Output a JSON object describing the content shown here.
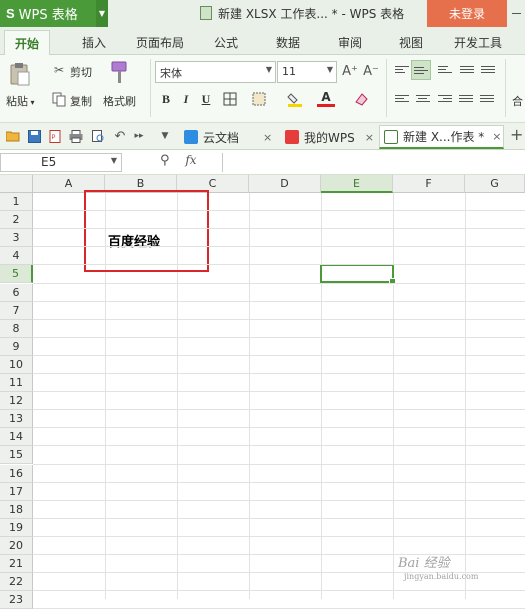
{
  "app": {
    "logo_letter": "S",
    "name": "WPS 表格",
    "window_title": "新建 XLSX 工作表... * - WPS 表格",
    "login_label": "未登录"
  },
  "ribbon_tabs": [
    "开始",
    "插入",
    "页面布局",
    "公式",
    "数据",
    "审阅",
    "视图",
    "开发工具"
  ],
  "ribbon": {
    "cut_label": "剪切",
    "copy_label": "复制",
    "paste_label": "粘贴",
    "format_painter_label": "格式刷",
    "font_name": "宋体",
    "font_size": "11",
    "bold": "B",
    "italic": "I",
    "underline": "U",
    "font_color_letter": "A",
    "grow_font": "A⁺",
    "shrink_font": "A⁻",
    "truncated_group": "合"
  },
  "doc_tabs": [
    {
      "label": "云文档",
      "close": "×"
    },
    {
      "label": "我的WPS",
      "close": "×"
    },
    {
      "label": "新建 X...作表 *",
      "close": "×"
    }
  ],
  "formula_bar": {
    "name_box": "E5",
    "fx_label": "fx",
    "formula": ""
  },
  "sheet": {
    "columns": [
      "A",
      "B",
      "C",
      "D",
      "E",
      "F",
      "G"
    ],
    "rows": [
      "1",
      "2",
      "3",
      "4",
      "5",
      "6",
      "7",
      "8",
      "9",
      "10",
      "11",
      "12",
      "13",
      "14",
      "15",
      "16",
      "17",
      "18",
      "19",
      "20",
      "21",
      "22",
      "23"
    ],
    "selected_column": "E",
    "selected_row": "5",
    "cell_b3": "百度经验"
  },
  "watermark": {
    "text": "Bai 经验",
    "url": "jingyan.baidu.com"
  },
  "colors": {
    "brand_green": "#4a9a3a",
    "login_orange": "#e6704c",
    "highlight_red": "#d9262b"
  }
}
